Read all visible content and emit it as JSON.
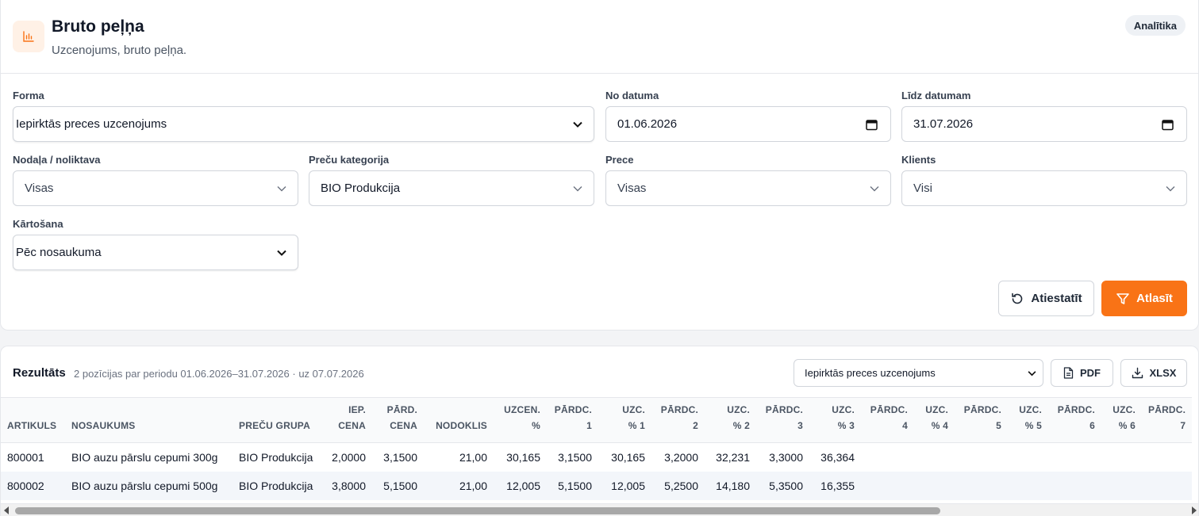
{
  "header": {
    "title": "Bruto peļņa",
    "subtitle": "Uzcenojums, bruto peļņa.",
    "badge": "Analītika",
    "icon": "bar-chart-icon",
    "accent": "#f97316"
  },
  "filters": {
    "forma": {
      "label": "Forma",
      "value": "Iepirktās preces uzcenojums"
    },
    "no_datuma": {
      "label": "No datuma",
      "value": "01.06.2026"
    },
    "lidz_datumam": {
      "label": "Līdz datumam",
      "value": "31.07.2026"
    },
    "nodala": {
      "label": "Nodaļa / noliktava",
      "value": "Visas"
    },
    "kategorija": {
      "label": "Preču kategorija",
      "value": "BIO Produkcija"
    },
    "prece": {
      "label": "Prece",
      "value": "Visas"
    },
    "klients": {
      "label": "Klients",
      "value": "Visi"
    },
    "kartosana": {
      "label": "Kārtošana",
      "value": "Pēc nosaukuma"
    },
    "reset_label": "Atiestatīt",
    "submit_label": "Atlasīt"
  },
  "results": {
    "title": "Rezultāts",
    "meta": "2 pozīcijas par periodu 01.06.2026–31.07.2026 · uz 07.07.2026",
    "form_select": "Iepirktās preces uzcenojums",
    "pdf_label": "PDF",
    "xlsx_label": "XLSX",
    "columns": [
      {
        "l1": "",
        "l2": "ARTIKULS"
      },
      {
        "l1": "",
        "l2": "NOSAUKUMS"
      },
      {
        "l1": "",
        "l2": "PREČU GRUPA"
      },
      {
        "l1": "IEP.",
        "l2": "CENA"
      },
      {
        "l1": "PĀRD.",
        "l2": "CENA"
      },
      {
        "l1": "",
        "l2": "NODOKLIS"
      },
      {
        "l1": "UZCEN.",
        "l2": "%"
      },
      {
        "l1": "PĀRDC.",
        "l2": "1"
      },
      {
        "l1": "UZC.",
        "l2": "% 1"
      },
      {
        "l1": "PĀRDC.",
        "l2": "2"
      },
      {
        "l1": "UZC.",
        "l2": "% 2"
      },
      {
        "l1": "PĀRDC.",
        "l2": "3"
      },
      {
        "l1": "UZC.",
        "l2": "% 3"
      },
      {
        "l1": "PĀRDC.",
        "l2": "4"
      },
      {
        "l1": "UZC.",
        "l2": "% 4"
      },
      {
        "l1": "PĀRDC.",
        "l2": "5"
      },
      {
        "l1": "UZC.",
        "l2": "% 5"
      },
      {
        "l1": "PĀRDC.",
        "l2": "6"
      },
      {
        "l1": "UZC.",
        "l2": "% 6"
      },
      {
        "l1": "PĀRDC.",
        "l2": "7"
      }
    ],
    "rows": [
      [
        "800001",
        "BIO auzu pārslu cepumi 300g",
        "BIO Produkcija",
        "2,0000",
        "3,1500",
        "21,00",
        "30,165",
        "3,1500",
        "30,165",
        "3,2000",
        "32,231",
        "3,3000",
        "36,364",
        "",
        "",
        "",
        "",
        "",
        "",
        ""
      ],
      [
        "800002",
        "BIO auzu pārslu cepumi 500g",
        "BIO Produkcija",
        "3,8000",
        "5,1500",
        "21,00",
        "12,005",
        "5,1500",
        "12,005",
        "5,2500",
        "14,180",
        "5,3500",
        "16,355",
        "",
        "",
        "",
        "",
        "",
        "",
        ""
      ]
    ]
  }
}
